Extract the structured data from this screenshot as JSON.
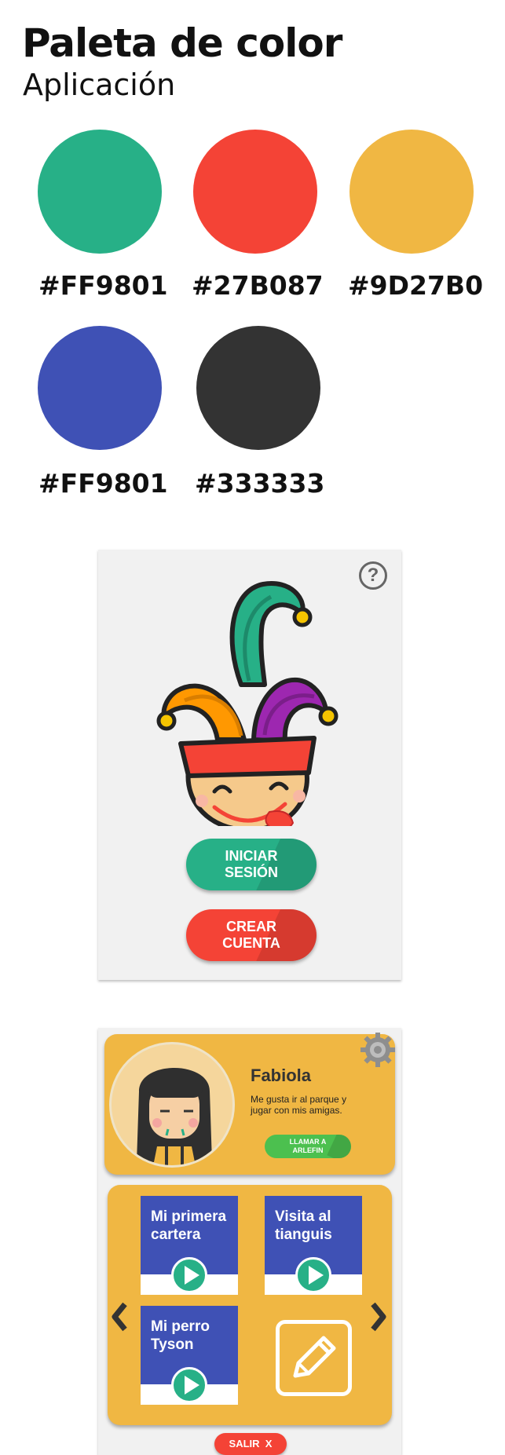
{
  "header": {
    "title": "Paleta de color",
    "subtitle": "Aplicación"
  },
  "palette": [
    {
      "color": "#27B087",
      "label": "#FF9801"
    },
    {
      "color": "#F44336",
      "label": "#27B087"
    },
    {
      "color": "#F0B743",
      "label": "#9D27B0"
    },
    {
      "color": "#3F51B5",
      "label": "#FF9801"
    },
    {
      "color": "#333333",
      "label": "#333333"
    }
  ],
  "login_screen": {
    "help_icon": "question-circle-icon",
    "logo_icon": "jester-face-icon",
    "login_button": "INICIAR\nSESIÓN",
    "signup_button": "CREAR\nCUENTA"
  },
  "profile_screen": {
    "settings_icon": "gear-icon",
    "name": "Fabiola",
    "bio": "Me gusta ir al parque y jugar con mis amigas.",
    "call_button": "LLAMAR A ARLEFIN",
    "stories": [
      {
        "title": "Mi primera cartera"
      },
      {
        "title": "Visita al tianguis"
      },
      {
        "title": "Mi perro Tyson"
      }
    ],
    "edit_icon": "pencil-icon",
    "exit_button": "SALIR  X"
  },
  "colors": {
    "green": "#27B087",
    "red": "#F44336",
    "yellow": "#F0B743",
    "blue": "#3F51B5",
    "dark": "#333333",
    "purple": "#9D27B0",
    "orange": "#FF9801"
  }
}
